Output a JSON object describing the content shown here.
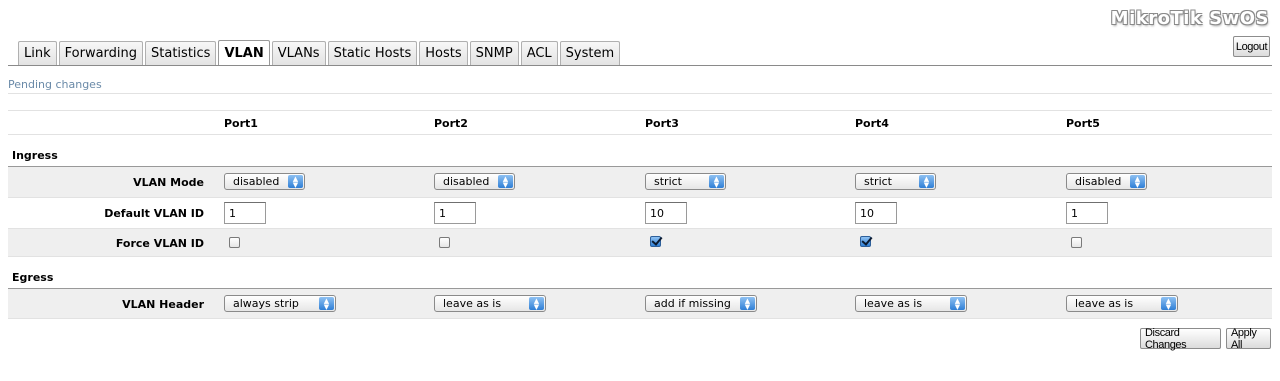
{
  "brand": "MikroTik SwOS",
  "logout_label": "Logout",
  "tabs": [
    {
      "label": "Link",
      "active": false
    },
    {
      "label": "Forwarding",
      "active": false
    },
    {
      "label": "Statistics",
      "active": false
    },
    {
      "label": "VLAN",
      "active": true
    },
    {
      "label": "VLANs",
      "active": false
    },
    {
      "label": "Static Hosts",
      "active": false
    },
    {
      "label": "Hosts",
      "active": false
    },
    {
      "label": "SNMP",
      "active": false
    },
    {
      "label": "ACL",
      "active": false
    },
    {
      "label": "System",
      "active": false
    }
  ],
  "pending_text": "Pending changes",
  "ports": [
    "Port1",
    "Port2",
    "Port3",
    "Port4",
    "Port5"
  ],
  "ingress": {
    "title": "Ingress",
    "vlan_mode_label": "VLAN Mode",
    "vlan_mode": [
      "disabled",
      "disabled",
      "strict",
      "strict",
      "disabled"
    ],
    "default_vlan_label": "Default VLAN ID",
    "default_vlan": [
      "1",
      "1",
      "10",
      "10",
      "1"
    ],
    "force_vlan_label": "Force VLAN ID",
    "force_vlan": [
      false,
      false,
      true,
      true,
      false
    ]
  },
  "egress": {
    "title": "Egress",
    "vlan_header_label": "VLAN Header",
    "vlan_header": [
      "always strip",
      "leave as is",
      "add if missing",
      "leave as is",
      "leave as is"
    ]
  },
  "buttons": {
    "discard": "Discard Changes",
    "apply": "Apply All"
  }
}
